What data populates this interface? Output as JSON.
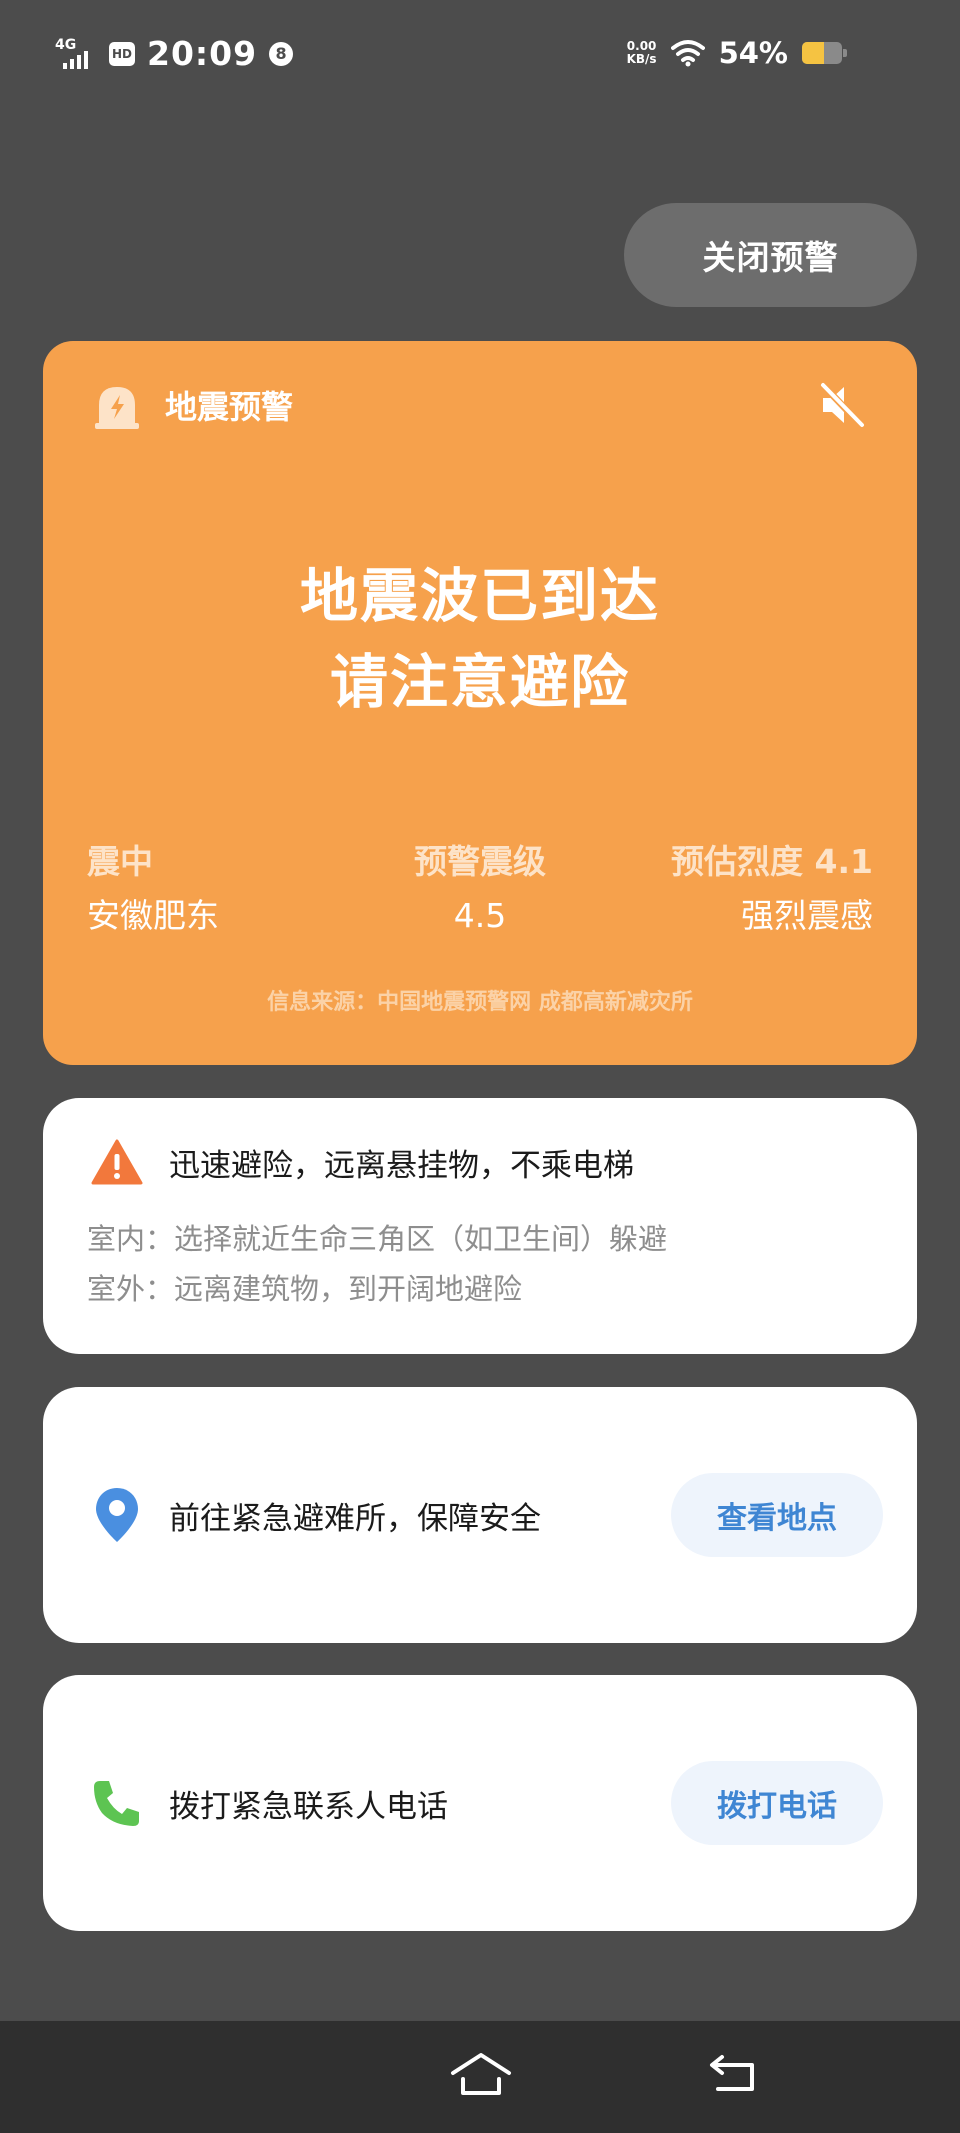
{
  "status_bar": {
    "network": "4G",
    "hd": "HD",
    "time": "20:09",
    "badge": "8",
    "speed_value": "0.00",
    "speed_unit": "KB/s",
    "battery": "54%"
  },
  "close_button": {
    "label": "关闭预警"
  },
  "alert": {
    "title": "地震预警",
    "headline_1": "地震波已到达",
    "headline_2": "请注意避险",
    "epicenter_label": "震中",
    "epicenter_value": "安徽肥东",
    "magnitude_label": "预警震级",
    "magnitude_value": "4.5",
    "intensity_label": "预估烈度 4.1",
    "intensity_value": "强烈震感",
    "source": "信息来源：中国地震预警网 成都高新减灾所",
    "color": "#f6a14c"
  },
  "safety": {
    "title": "迅速避险，远离悬挂物，不乘电梯",
    "indoor": "室内：选择就近生命三角区（如卫生间）躲避",
    "outdoor": "室外：远离建筑物，到开阔地避险"
  },
  "shelter": {
    "text": "前往紧急避难所，保障安全",
    "button": "查看地点"
  },
  "call": {
    "text": "拨打紧急联系人电话",
    "button": "拨打电话"
  },
  "icons": [
    "alarm-icon",
    "mute-icon",
    "warning-icon",
    "location-pin-icon",
    "phone-icon",
    "home-icon",
    "back-icon"
  ]
}
